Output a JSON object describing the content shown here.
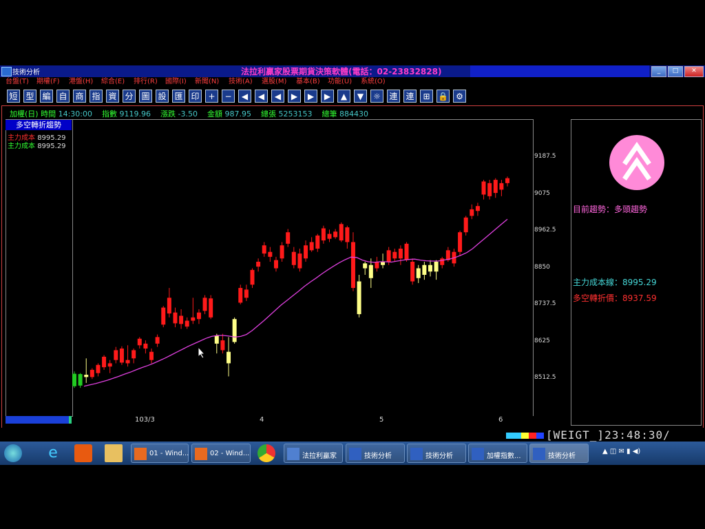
{
  "window": {
    "title": "技術分析",
    "app_title": "法拉利贏家股票期貨決策軟體(電話：02-23832828)"
  },
  "menu": [
    "台盤(T)",
    "期權(F)",
    "港盤(H)",
    "綜合(E)",
    "排行(R)",
    "國際(I)",
    "新聞(N)",
    "技術(A)",
    "選股(M)",
    "基本(B)",
    "功能(U)",
    "系統(O)"
  ],
  "toolbar": [
    "短",
    "型",
    "編",
    "自",
    "商",
    "指",
    "資",
    "分",
    "圖",
    "設",
    "匯",
    "印",
    "+",
    "−",
    "◀",
    "◀",
    "◀",
    "▶",
    "▶",
    "▶",
    "▲",
    "▼",
    "☼",
    "連",
    "連",
    "⊞",
    "🔒",
    "⚙"
  ],
  "infobar": {
    "name": "加權(日)",
    "time_label": "時間",
    "time_value": "14:30:00",
    "index_label": "指數",
    "index_value": "9119.96",
    "change_label": "漲跌",
    "change_value": "-3.50",
    "amount_label": "金額",
    "amount_value": "987.95",
    "sheets_label": "總張",
    "sheets_value": "5253153",
    "trades_label": "總筆",
    "trades_value": "884430"
  },
  "legend": {
    "title": "多空轉折趨勢",
    "rows": [
      {
        "label": "主力成本",
        "value": "8995.29"
      },
      {
        "label": "主力成本",
        "value": "8995.29"
      }
    ]
  },
  "right_panel": {
    "trend_label": "目前趨勢：多頭趨勢",
    "main_cost_line": "主力成本線：8995.29",
    "reversal_price": "多空轉折價：8937.59"
  },
  "colors": {
    "up": "#ff1a1a",
    "down_yellow": "#ffff88",
    "start_green": "#22cc22",
    "ma_line": "#e040e0",
    "trend_badge": "#ff8ad8"
  },
  "chart_data": {
    "type": "candlestick",
    "y_ticks": [
      8512.5,
      8625.0,
      8737.5,
      8850.0,
      8962.5,
      9075.0,
      9187.5
    ],
    "x_ticks": [
      "103/3",
      "4",
      "5",
      "6"
    ],
    "candles": [
      {
        "o": 8490,
        "h": 8535,
        "l": 8485,
        "c": 8528,
        "col": "g"
      },
      {
        "o": 8492,
        "h": 8530,
        "l": 8485,
        "c": 8527,
        "col": "g"
      },
      {
        "o": 8525,
        "h": 8575,
        "l": 8500,
        "c": 8518,
        "col": "y"
      },
      {
        "o": 8518,
        "h": 8545,
        "l": 8512,
        "c": 8540,
        "col": "r"
      },
      {
        "o": 8530,
        "h": 8560,
        "l": 8520,
        "c": 8555,
        "col": "r"
      },
      {
        "o": 8548,
        "h": 8585,
        "l": 8540,
        "c": 8580,
        "col": "r"
      },
      {
        "o": 8550,
        "h": 8570,
        "l": 8530,
        "c": 8560,
        "col": "r"
      },
      {
        "o": 8570,
        "h": 8610,
        "l": 8560,
        "c": 8600,
        "col": "r"
      },
      {
        "o": 8562,
        "h": 8612,
        "l": 8555,
        "c": 8605,
        "col": "r"
      },
      {
        "o": 8560,
        "h": 8615,
        "l": 8550,
        "c": 8570,
        "col": "r"
      },
      {
        "o": 8575,
        "h": 8605,
        "l": 8560,
        "c": 8600,
        "col": "r"
      },
      {
        "o": 8615,
        "h": 8640,
        "l": 8605,
        "c": 8635,
        "col": "r"
      },
      {
        "o": 8605,
        "h": 8630,
        "l": 8590,
        "c": 8620,
        "col": "r"
      },
      {
        "o": 8570,
        "h": 8605,
        "l": 8560,
        "c": 8595,
        "col": "r"
      },
      {
        "o": 8620,
        "h": 8648,
        "l": 8610,
        "c": 8640,
        "col": "r"
      },
      {
        "o": 8678,
        "h": 8735,
        "l": 8670,
        "c": 8730,
        "col": "r"
      },
      {
        "o": 8712,
        "h": 8790,
        "l": 8700,
        "c": 8760,
        "col": "r"
      },
      {
        "o": 8682,
        "h": 8730,
        "l": 8670,
        "c": 8715,
        "col": "r"
      },
      {
        "o": 8680,
        "h": 8725,
        "l": 8665,
        "c": 8705,
        "col": "r"
      },
      {
        "o": 8672,
        "h": 8700,
        "l": 8665,
        "c": 8690,
        "col": "r"
      },
      {
        "o": 8690,
        "h": 8760,
        "l": 8680,
        "c": 8700,
        "col": "r"
      },
      {
        "o": 8695,
        "h": 8725,
        "l": 8680,
        "c": 8715,
        "col": "r"
      },
      {
        "o": 8720,
        "h": 8768,
        "l": 8710,
        "c": 8760,
        "col": "r"
      },
      {
        "o": 8700,
        "h": 8768,
        "l": 8695,
        "c": 8758,
        "col": "r"
      },
      {
        "o": 8620,
        "h": 8650,
        "l": 8590,
        "c": 8645,
        "col": "y"
      },
      {
        "o": 8600,
        "h": 8650,
        "l": 8590,
        "c": 8630,
        "col": "r"
      },
      {
        "o": 8560,
        "h": 8640,
        "l": 8520,
        "c": 8595,
        "col": "y"
      },
      {
        "o": 8625,
        "h": 8700,
        "l": 8620,
        "c": 8695,
        "col": "y"
      },
      {
        "o": 8745,
        "h": 8800,
        "l": 8740,
        "c": 8790,
        "col": "r"
      },
      {
        "o": 8760,
        "h": 8800,
        "l": 8750,
        "c": 8785,
        "col": "r"
      },
      {
        "o": 8800,
        "h": 8850,
        "l": 8790,
        "c": 8845,
        "col": "r"
      },
      {
        "o": 8855,
        "h": 8880,
        "l": 8840,
        "c": 8870,
        "col": "r"
      },
      {
        "o": 8895,
        "h": 8930,
        "l": 8885,
        "c": 8920,
        "col": "r"
      },
      {
        "o": 8885,
        "h": 8915,
        "l": 8870,
        "c": 8900,
        "col": "r"
      },
      {
        "o": 8850,
        "h": 8885,
        "l": 8840,
        "c": 8875,
        "col": "r"
      },
      {
        "o": 8880,
        "h": 8930,
        "l": 8870,
        "c": 8920,
        "col": "r"
      },
      {
        "o": 8925,
        "h": 8970,
        "l": 8915,
        "c": 8960,
        "col": "r"
      },
      {
        "o": 8860,
        "h": 8915,
        "l": 8850,
        "c": 8900,
        "col": "r"
      },
      {
        "o": 8850,
        "h": 8910,
        "l": 8840,
        "c": 8895,
        "col": "r"
      },
      {
        "o": 8880,
        "h": 8935,
        "l": 8870,
        "c": 8920,
        "col": "r"
      },
      {
        "o": 8905,
        "h": 8945,
        "l": 8900,
        "c": 8930,
        "col": "r"
      },
      {
        "o": 8910,
        "h": 8955,
        "l": 8900,
        "c": 8950,
        "col": "r"
      },
      {
        "o": 8935,
        "h": 8980,
        "l": 8925,
        "c": 8972,
        "col": "r"
      },
      {
        "o": 8940,
        "h": 8968,
        "l": 8930,
        "c": 8955,
        "col": "r"
      },
      {
        "o": 8945,
        "h": 8970,
        "l": 8940,
        "c": 8962,
        "col": "r"
      },
      {
        "o": 8935,
        "h": 8990,
        "l": 8930,
        "c": 8985,
        "col": "r"
      },
      {
        "o": 8930,
        "h": 8980,
        "l": 8910,
        "c": 8975,
        "col": "r"
      },
      {
        "o": 8930,
        "h": 8960,
        "l": 8780,
        "c": 8790,
        "col": "r"
      },
      {
        "o": 8810,
        "h": 8830,
        "l": 8700,
        "c": 8710,
        "col": "y"
      },
      {
        "o": 8850,
        "h": 8870,
        "l": 8830,
        "c": 8865,
        "col": "y"
      },
      {
        "o": 8820,
        "h": 8880,
        "l": 8790,
        "c": 8860,
        "col": "y"
      },
      {
        "o": 8850,
        "h": 8885,
        "l": 8840,
        "c": 8870,
        "col": "r"
      },
      {
        "o": 8870,
        "h": 8895,
        "l": 8850,
        "c": 8860,
        "col": "y"
      },
      {
        "o": 8870,
        "h": 8915,
        "l": 8860,
        "c": 8905,
        "col": "r"
      },
      {
        "o": 8880,
        "h": 8910,
        "l": 8870,
        "c": 8900,
        "col": "r"
      },
      {
        "o": 8880,
        "h": 8920,
        "l": 8860,
        "c": 8910,
        "col": "r"
      },
      {
        "o": 8875,
        "h": 8930,
        "l": 8870,
        "c": 8925,
        "col": "r"
      },
      {
        "o": 8810,
        "h": 8880,
        "l": 8800,
        "c": 8870,
        "col": "r"
      },
      {
        "o": 8820,
        "h": 8860,
        "l": 8805,
        "c": 8850,
        "col": "y"
      },
      {
        "o": 8830,
        "h": 8870,
        "l": 8815,
        "c": 8860,
        "col": "y"
      },
      {
        "o": 8840,
        "h": 8875,
        "l": 8825,
        "c": 8860,
        "col": "y"
      },
      {
        "o": 8840,
        "h": 8875,
        "l": 8815,
        "c": 8870,
        "col": "y"
      },
      {
        "o": 8860,
        "h": 8885,
        "l": 8850,
        "c": 8880,
        "col": "r"
      },
      {
        "o": 8875,
        "h": 8915,
        "l": 8870,
        "c": 8905,
        "col": "r"
      },
      {
        "o": 8865,
        "h": 8910,
        "l": 8855,
        "c": 8900,
        "col": "r"
      },
      {
        "o": 8900,
        "h": 8965,
        "l": 8890,
        "c": 8960,
        "col": "r"
      },
      {
        "o": 8960,
        "h": 9010,
        "l": 8950,
        "c": 9005,
        "col": "r"
      },
      {
        "o": 9010,
        "h": 9045,
        "l": 9000,
        "c": 9030,
        "col": "r"
      },
      {
        "o": 9025,
        "h": 9050,
        "l": 9010,
        "c": 9040,
        "col": "r"
      },
      {
        "o": 9075,
        "h": 9120,
        "l": 9060,
        "c": 9115,
        "col": "r"
      },
      {
        "o": 9070,
        "h": 9120,
        "l": 9060,
        "c": 9110,
        "col": "r"
      },
      {
        "o": 9080,
        "h": 9125,
        "l": 9065,
        "c": 9120,
        "col": "r"
      },
      {
        "o": 9090,
        "h": 9120,
        "l": 9070,
        "c": 9110,
        "col": "r"
      },
      {
        "o": 9110,
        "h": 9130,
        "l": 9100,
        "c": 9125,
        "col": "r"
      }
    ],
    "ma": [
      8490,
      8494,
      8498,
      8503,
      8508,
      8514,
      8520,
      8527,
      8533,
      8540,
      8547,
      8553,
      8560,
      8568,
      8576,
      8585,
      8594,
      8603,
      8612,
      8620,
      8628,
      8636,
      8642,
      8645,
      8645,
      8643,
      8640,
      8642,
      8648,
      8660,
      8675,
      8690,
      8706,
      8722,
      8738,
      8752,
      8766,
      8780,
      8795,
      8808,
      8820,
      8833,
      8845,
      8856,
      8867,
      8876,
      8884,
      8883,
      8875,
      8870,
      8868,
      8870,
      8870,
      8869,
      8872,
      8875,
      8877,
      8878,
      8875,
      8873,
      8872,
      8872,
      8875,
      8878,
      8883,
      8890,
      8898,
      8910,
      8925,
      8940,
      8955,
      8970,
      8985,
      9000
    ]
  },
  "status": {
    "clock": "[WEIGT_]23:48:30/"
  },
  "taskbar": {
    "items": [
      "01 - Wind...",
      "02 - Wind...",
      "法拉利贏家",
      "技術分析",
      "技術分析",
      "加權指數...",
      "技術分析"
    ],
    "tray": "▲ ◫ ✉ ▮ ◀)"
  }
}
